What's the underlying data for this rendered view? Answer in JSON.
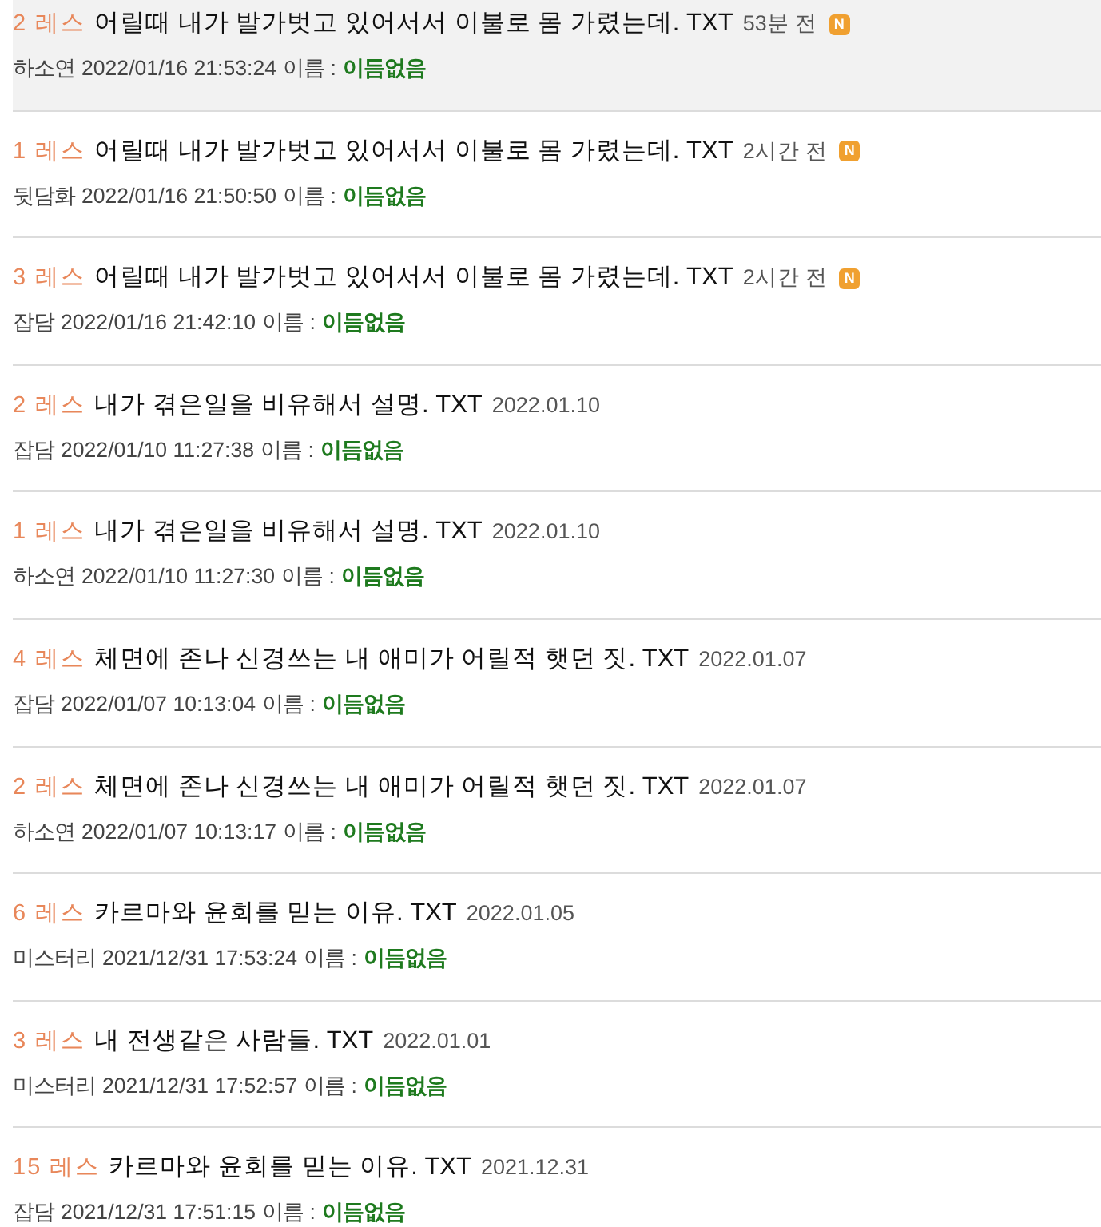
{
  "posts": [
    {
      "replies": "2 레스",
      "title": "어릴때 내가 발가벗고 있어서서 이불로 몸 가렸는데. TXT",
      "time": "53분 전",
      "badge": "N",
      "category": "하소연",
      "datetime": "2022/01/16 21:53:24",
      "name_label": "이름 :",
      "name": "이듬없음",
      "highlighted": true
    },
    {
      "replies": "1 레스",
      "title": "어릴때 내가 발가벗고 있어서서 이불로 몸 가렸는데. TXT",
      "time": "2시간 전",
      "badge": "N",
      "category": "뒷담화",
      "datetime": "2022/01/16 21:50:50",
      "name_label": "이름 :",
      "name": "이듬없음",
      "highlighted": false
    },
    {
      "replies": "3 레스",
      "title": "어릴때 내가 발가벗고 있어서서 이불로 몸 가렸는데. TXT",
      "time": "2시간 전",
      "badge": "N",
      "category": "잡담",
      "datetime": "2022/01/16 21:42:10",
      "name_label": "이름 :",
      "name": "이듬없음",
      "highlighted": false
    },
    {
      "replies": "2 레스",
      "title": "내가 겪은일을 비유해서 설명. TXT",
      "time": "2022.01.10",
      "category": "잡담",
      "datetime": "2022/01/10 11:27:38",
      "name_label": "이름 :",
      "name": "이듬없음",
      "highlighted": false
    },
    {
      "replies": "1 레스",
      "title": "내가 겪은일을 비유해서 설명. TXT",
      "time": "2022.01.10",
      "category": "하소연",
      "datetime": "2022/01/10 11:27:30",
      "name_label": "이름 :",
      "name": "이듬없음",
      "highlighted": false
    },
    {
      "replies": "4 레스",
      "title": "체면에 존나 신경쓰는 내 애미가 어릴적 햇던 짓. TXT",
      "time": "2022.01.07",
      "category": "잡담",
      "datetime": "2022/01/07 10:13:04",
      "name_label": "이름 :",
      "name": "이듬없음",
      "highlighted": false
    },
    {
      "replies": "2 레스",
      "title": "체면에 존나 신경쓰는 내 애미가 어릴적 햇던 짓. TXT",
      "time": "2022.01.07",
      "category": "하소연",
      "datetime": "2022/01/07 10:13:17",
      "name_label": "이름 :",
      "name": "이듬없음",
      "highlighted": false
    },
    {
      "replies": "6 레스",
      "title": "카르마와 윤회를 믿는 이유. TXT",
      "time": "2022.01.05",
      "category": "미스터리",
      "datetime": "2021/12/31 17:53:24",
      "name_label": "이름 :",
      "name": "이듬없음",
      "highlighted": false
    },
    {
      "replies": "3 레스",
      "title": "내 전생같은 사람들. TXT",
      "time": "2022.01.01",
      "category": "미스터리",
      "datetime": "2021/12/31 17:52:57",
      "name_label": "이름 :",
      "name": "이듬없음",
      "highlighted": false
    },
    {
      "replies": "15 레스",
      "title": "카르마와 윤회를 믿는 이유. TXT",
      "time": "2021.12.31",
      "category": "잡담",
      "datetime": "2021/12/31 17:51:15",
      "name_label": "이름 :",
      "name": "이듬없음",
      "highlighted": false
    }
  ]
}
